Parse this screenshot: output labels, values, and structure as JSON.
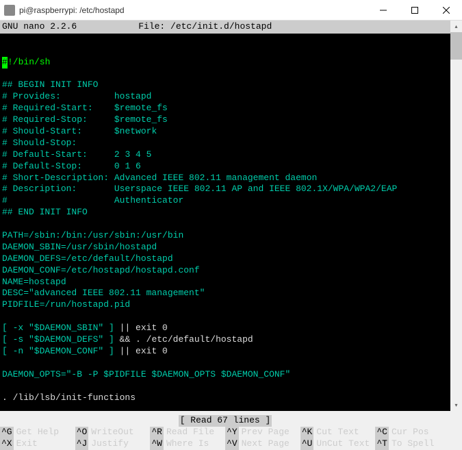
{
  "titlebar": {
    "text": "pi@raspberrypi: /etc/hostapd"
  },
  "nano": {
    "version": "GNU nano 2.2.6",
    "file_label": "File: /etc/init.d/hostapd"
  },
  "script": {
    "shebang": "!/bin/sh",
    "begin": "## BEGIN INIT INFO",
    "lines": [
      {
        "k": "# Provides:",
        "v": "hostapd"
      },
      {
        "k": "# Required-Start:",
        "v": "$remote_fs"
      },
      {
        "k": "# Required-Stop:",
        "v": "$remote_fs"
      },
      {
        "k": "# Should-Start:",
        "v": "$network"
      },
      {
        "k": "# Should-Stop:",
        "v": ""
      },
      {
        "k": "# Default-Start:",
        "v": "2 3 4 5"
      },
      {
        "k": "# Default-Stop:",
        "v": "0 1 6"
      },
      {
        "k": "# Short-Description:",
        "v": "Advanced IEEE 802.11 management daemon"
      },
      {
        "k": "# Description:",
        "v": "Userspace IEEE 802.11 AP and IEEE 802.1X/WPA/WPA2/EAP"
      }
    ],
    "desc_cont": "Authenticator",
    "end": "## END INIT INFO",
    "vars": [
      "PATH=/sbin:/bin:/usr/sbin:/usr/bin",
      "DAEMON_SBIN=/usr/sbin/hostapd",
      "DAEMON_DEFS=/etc/default/hostapd",
      "DAEMON_CONF=/etc/hostapd/hostapd.conf",
      "NAME=hostapd",
      "DESC=\"advanced IEEE 802.11 management\"",
      "PIDFILE=/run/hostapd.pid"
    ],
    "tests": [
      {
        "pre": "[ -x \"$DAEMON_SBIN\" ] ",
        "post": "|| exit 0"
      },
      {
        "pre": "[ -s \"$DAEMON_DEFS\" ] ",
        "post": "&& . /etc/default/hostapd"
      },
      {
        "pre": "[ -n \"$DAEMON_CONF\" ] ",
        "post": "|| exit 0"
      }
    ],
    "opts": "DAEMON_OPTS=\"-B -P $PIDFILE $DAEMON_OPTS $DAEMON_CONF\"",
    "source": ". /lib/lsb/init-functions"
  },
  "status": {
    "read_lines": "[ Read 67 lines ]"
  },
  "shortcuts": {
    "r1": [
      {
        "key": "^G",
        "label": "Get Help"
      },
      {
        "key": "^O",
        "label": "WriteOut"
      },
      {
        "key": "^R",
        "label": "Read File"
      },
      {
        "key": "^Y",
        "label": "Prev Page"
      },
      {
        "key": "^K",
        "label": "Cut Text"
      },
      {
        "key": "^C",
        "label": "Cur Pos"
      }
    ],
    "r2": [
      {
        "key": "^X",
        "label": "Exit"
      },
      {
        "key": "^J",
        "label": "Justify"
      },
      {
        "key": "^W",
        "label": "Where Is"
      },
      {
        "key": "^V",
        "label": "Next Page"
      },
      {
        "key": "^U",
        "label": "UnCut Text"
      },
      {
        "key": "^T",
        "label": "To Spell"
      }
    ]
  }
}
